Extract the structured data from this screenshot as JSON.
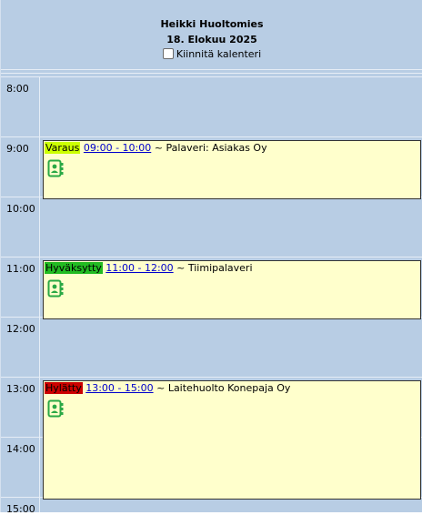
{
  "header": {
    "person": "Heikki Huoltomies",
    "date": "18. Elokuu 2025",
    "pin_label": "Kiinnitä kalenteri"
  },
  "hours": [
    "8:00",
    "9:00",
    "10:00",
    "11:00",
    "12:00",
    "13:00",
    "14:00",
    "15:00"
  ],
  "events": [
    {
      "status": "Varaus",
      "status_color": "#ccff00",
      "time": "09:00 - 10:00",
      "separator": " ~ ",
      "title": "Palaveri: Asiakas Oy",
      "icon": "contact-card-icon"
    },
    {
      "status": "Hyväksytty",
      "status_color": "#22bb22",
      "time": "11:00 - 12:00",
      "separator": " ~ ",
      "title": "Tiimipalaveri",
      "icon": "contact-card-icon"
    },
    {
      "status": "Hylätty",
      "status_color": "#cc0000",
      "time": "13:00 - 15:00",
      "separator": " ~ ",
      "title": "Laitehuolto Konepaja Oy",
      "icon": "contact-card-icon"
    }
  ],
  "colors": {
    "background": "#b8cde4",
    "event_background": "#ffffcc",
    "icon_green": "#2aa845",
    "link": "#0000cc"
  }
}
